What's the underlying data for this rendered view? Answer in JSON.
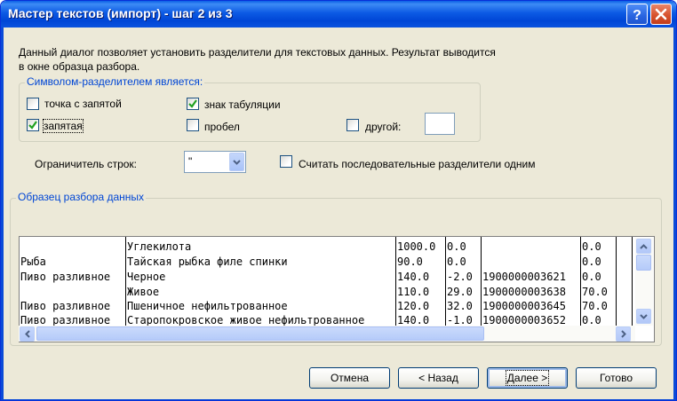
{
  "window": {
    "title": "Мастер текстов (импорт) - шаг 2 из 3",
    "help_icon": "question-mark-icon",
    "close_icon": "close-x-icon"
  },
  "description": {
    "line1": "Данный диалог позволяет установить разделители для текстовых данных. Результат выводится",
    "line2": "в окне образца разбора."
  },
  "delimiters": {
    "legend": "Символом-разделителем является:",
    "semicolon": {
      "label": "точка с запятой",
      "checked": false
    },
    "tab": {
      "label": "знак табуляции",
      "checked": true
    },
    "comma": {
      "label": "запятая",
      "checked": true
    },
    "space": {
      "label": "пробел",
      "checked": false
    },
    "other": {
      "label": "другой:",
      "checked": false,
      "value": ""
    }
  },
  "text_qualifier": {
    "label": "Ограничитель строк:",
    "value": "\""
  },
  "consecutive": {
    "label": "Считать последовательные разделители одним",
    "checked": false
  },
  "preview": {
    "legend": "Образец разбора данных",
    "rows": [
      [
        "",
        "Углекилота",
        "1000.0",
        "0.0",
        "",
        "0.0"
      ],
      [
        "Рыба",
        "Тайская рыбка филе спинки",
        "90.0",
        "0.0",
        "",
        "0.0"
      ],
      [
        "Пиво разливное",
        "Черное",
        "140.0",
        "-2.0",
        "1900000003621",
        "0.0"
      ],
      [
        "",
        "Живое",
        "110.0",
        "29.0",
        "1900000003638",
        "70.0"
      ],
      [
        "Пиво разливное",
        "Пшеничное нефильтрованное",
        "120.0",
        "32.0",
        "1900000003645",
        "70.0"
      ],
      [
        "Пиво разливное",
        "Старопокровское живое нефильтрованное",
        "140.0",
        "-1.0",
        "1900000003652",
        "0.0"
      ]
    ]
  },
  "buttons": {
    "cancel": "Отмена",
    "back": "< Назад",
    "next": "Далее >",
    "finish": "Готово"
  }
}
